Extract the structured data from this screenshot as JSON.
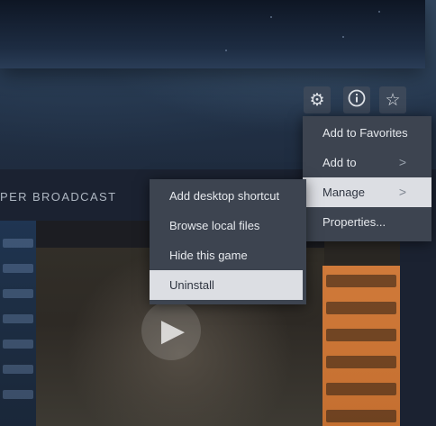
{
  "toolbar": {
    "icons": [
      "gear-icon",
      "info-icon",
      "star-icon"
    ]
  },
  "section": {
    "title": "PER BROADCAST"
  },
  "context_menu": {
    "items": [
      {
        "label": "Add to Favorites",
        "has_submenu": false
      },
      {
        "label": "Add to",
        "has_submenu": true
      },
      {
        "label": "Manage",
        "has_submenu": true,
        "highlighted": true
      },
      {
        "label": "Properties...",
        "has_submenu": false
      }
    ]
  },
  "manage_submenu": {
    "items": [
      {
        "label": "Add desktop shortcut"
      },
      {
        "label": "Browse local files"
      },
      {
        "label": "Hide this game"
      },
      {
        "label": "Uninstall",
        "highlighted": true
      }
    ]
  },
  "colors": {
    "menu_bg": "#3d4450",
    "menu_highlight": "#dcdee3",
    "page_bg": "#1b2636"
  }
}
